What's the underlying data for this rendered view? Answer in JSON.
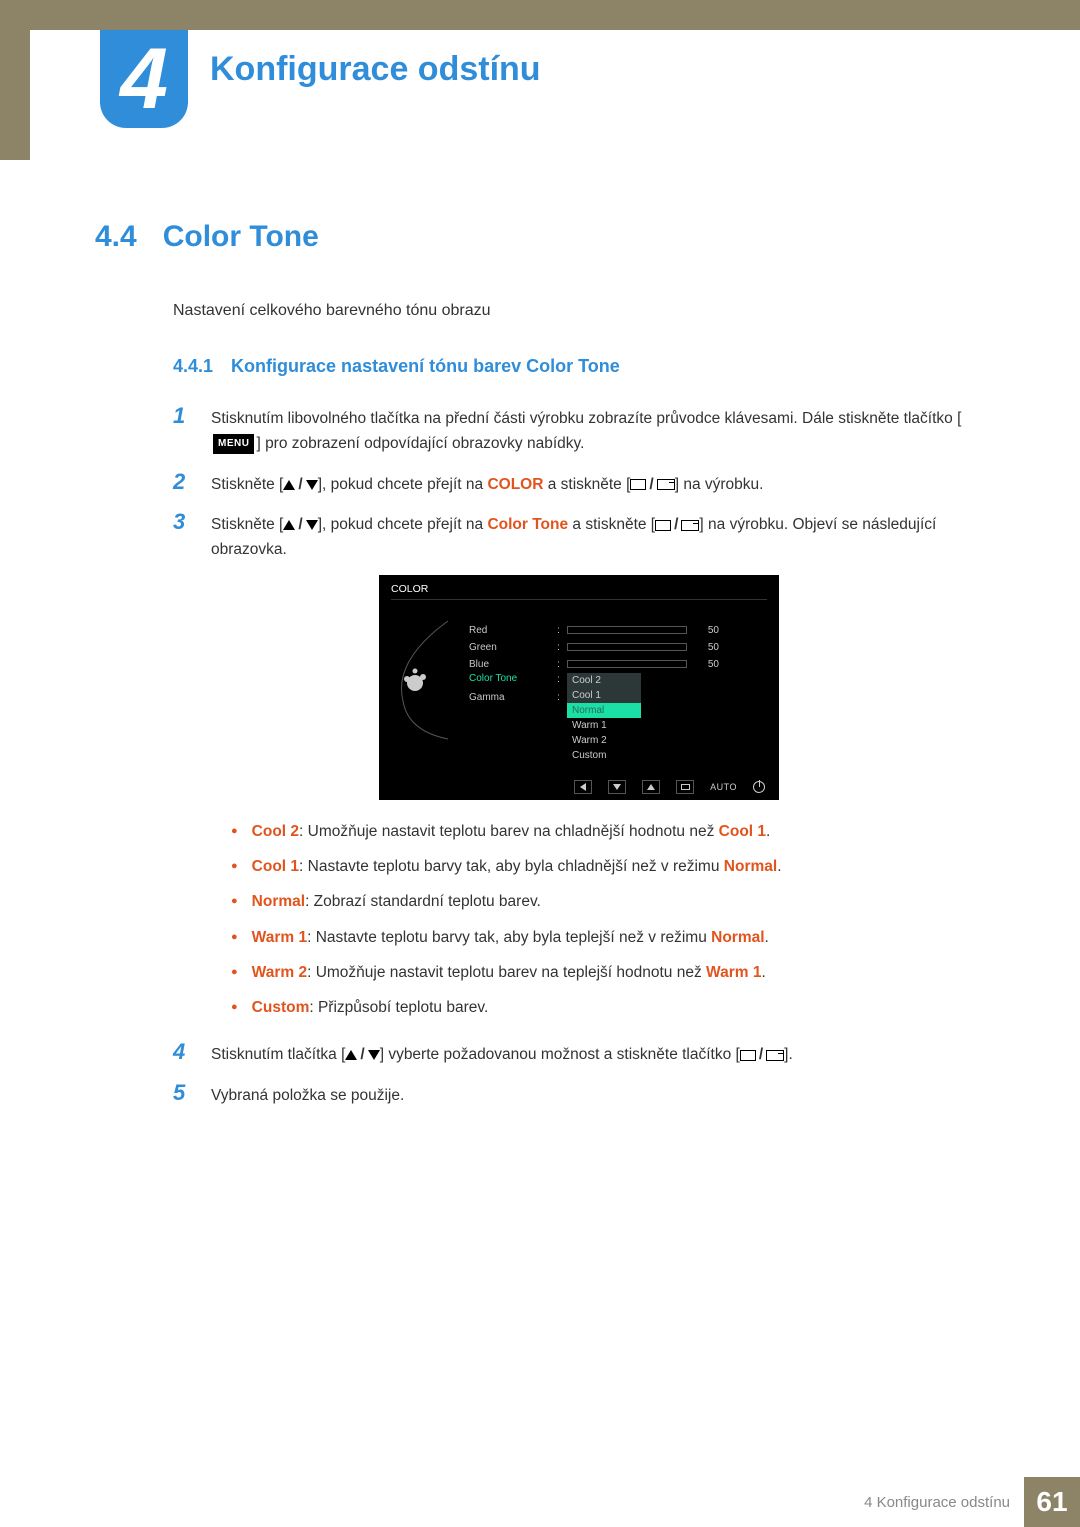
{
  "chapter": {
    "number": "4",
    "title": "Konfigurace odstínu"
  },
  "section": {
    "number": "4.4",
    "title": "Color Tone"
  },
  "intro": "Nastavení celkového barevného tónu obrazu",
  "subsection": {
    "number": "4.4.1",
    "title": "Konfigurace nastavení tónu barev Color Tone"
  },
  "steps": {
    "s1": {
      "num": "1",
      "a": "Stisknutím libovolného tlačítka na přední části výrobku zobrazíte průvodce klávesami. Dále stiskněte tlačítko [",
      "menu": "MENU",
      "b": "] pro zobrazení odpovídající obrazovky nabídky."
    },
    "s2": {
      "num": "2",
      "a": "Stiskněte [",
      "mid": "], pokud chcete přejít na ",
      "kw": "COLOR",
      "b": " a stiskněte [",
      "c": "] na výrobku."
    },
    "s3": {
      "num": "3",
      "a": "Stiskněte [",
      "mid": "], pokud chcete přejít na ",
      "kw": "Color Tone",
      "b": " a stiskněte [",
      "c": "] na výrobku. Objeví se následující obrazovka."
    },
    "s4": {
      "num": "4",
      "a": "Stisknutím tlačítka [",
      "mid": "] vyberte požadovanou možnost a stiskněte tlačítko [",
      "b": "]."
    },
    "s5": {
      "num": "5",
      "text": "Vybraná položka se použije."
    }
  },
  "osd": {
    "title": "COLOR",
    "rows": {
      "red": {
        "label": "Red",
        "val": "50"
      },
      "green": {
        "label": "Green",
        "val": "50"
      },
      "blue": {
        "label": "Blue",
        "val": "50"
      },
      "ct": {
        "label": "Color Tone"
      },
      "gamma": {
        "label": "Gamma"
      }
    },
    "options": {
      "o1": "Cool 2",
      "o2": "Cool 1",
      "o3": "Normal",
      "o4": "Warm 1",
      "o5": "Warm 2",
      "o6": "Custom"
    },
    "auto": "AUTO"
  },
  "bullets": {
    "b1": {
      "kw": "Cool 2",
      "a": ": Umožňuje nastavit teplotu barev na chladnější hodnotu než ",
      "kw2": "Cool 1",
      "b": "."
    },
    "b2": {
      "kw": "Cool 1",
      "a": ": Nastavte teplotu barvy tak, aby byla chladnější než v režimu ",
      "kw2": "Normal",
      "b": "."
    },
    "b3": {
      "kw": "Normal",
      "a": ": Zobrazí standardní teplotu barev."
    },
    "b4": {
      "kw": "Warm 1",
      "a": ": Nastavte teplotu barvy tak, aby byla teplejší než v režimu ",
      "kw2": "Normal",
      "b": "."
    },
    "b5": {
      "kw": "Warm 2",
      "a": ": Umožňuje nastavit teplotu barev na teplejší hodnotu než ",
      "kw2": "Warm 1",
      "b": "."
    },
    "b6": {
      "kw": "Custom",
      "a": ": Přizpůsobí teplotu barev."
    }
  },
  "footer": {
    "text": "4 Konfigurace odstínu",
    "page": "61"
  }
}
